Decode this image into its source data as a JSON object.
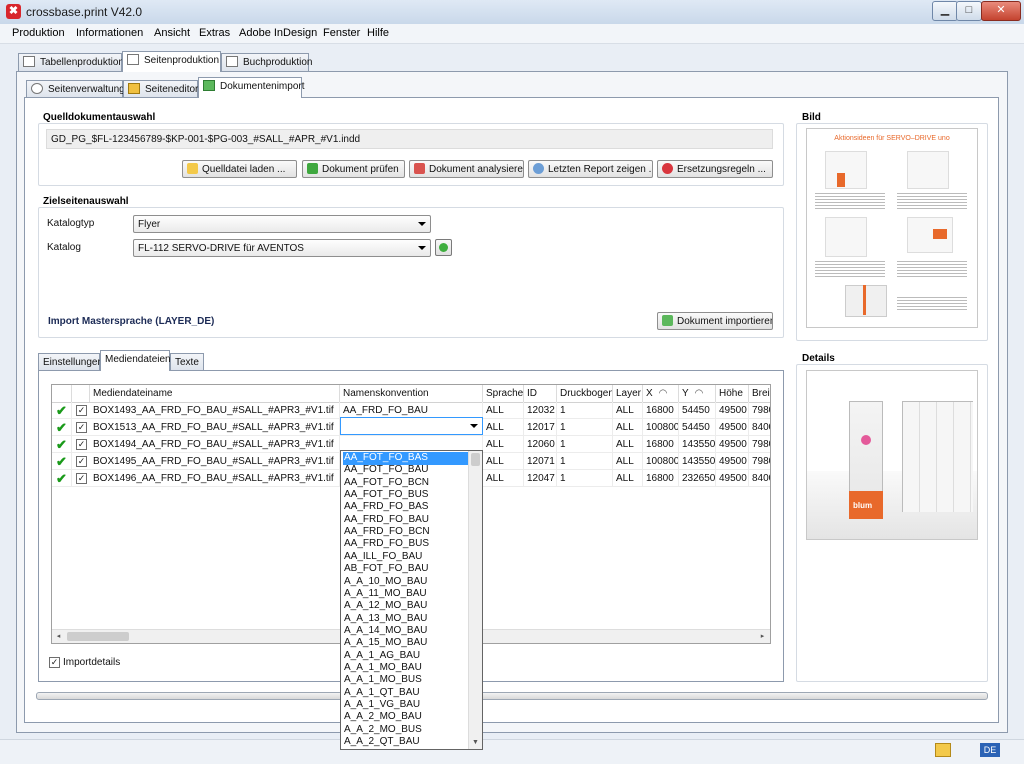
{
  "window": {
    "title": "crossbase.print V42.0",
    "app_icon_glyph": "✖",
    "btn_min": "▁",
    "btn_max": "□",
    "btn_close": "✕"
  },
  "menu": [
    "Produktion",
    "Informationen",
    "Ansicht",
    "Extras",
    "Adobe InDesign",
    "Fenster",
    "Hilfe"
  ],
  "main_tabs": [
    "Tabellenproduktion",
    "Seitenproduktion",
    "Buchproduktion"
  ],
  "sub_tabs": [
    "Seitenverwaltung",
    "Seiteneditor",
    "Dokumentenimport"
  ],
  "quell": {
    "title": "Quelldokumentauswahl",
    "path": "GD_PG_$FL-123456789-$KP-001-$PG-003_#SALL_#APR_#V1.indd",
    "buttons": [
      "Quelldatei laden ...",
      "Dokument prüfen",
      "Dokument analysieren",
      "Letzten Report zeigen ...",
      "Ersetzungsregeln ..."
    ]
  },
  "ziel": {
    "title": "Zielseitenauswahl",
    "katalogtyp_label": "Katalogtyp",
    "katalogtyp_value": "Flyer",
    "katalog_label": "Katalog",
    "katalog_value": "FL-112 SERVO-DRIVE für AVENTOS",
    "import_master": "Import Mastersprache (LAYER_DE)",
    "import_button": "Dokument importieren"
  },
  "inner_tabs": [
    "Einstellungen",
    "Mediendateien",
    "Texte"
  ],
  "grid": {
    "headers": [
      "Mediendateiname",
      "Namenskonvention",
      "Sprache",
      "ID",
      "Druckbogen",
      "Layer",
      "X",
      "Y",
      "Höhe",
      "Breit"
    ],
    "rows": [
      {
        "name": "BOX1493_AA_FRD_FO_BAU_#SALL_#APR3_#V1.tif",
        "konv": "AA_FRD_FO_BAU",
        "sprache": "ALL",
        "id": "12032",
        "druck": "1",
        "layer": "ALL",
        "x": "16800",
        "y": "54450",
        "hoehe": "49500",
        "breite": "7980"
      },
      {
        "name": "BOX1513_AA_FRD_FO_BAU_#SALL_#APR3_#V1.tif",
        "konv": "",
        "sprache": "ALL",
        "id": "12017",
        "druck": "1",
        "layer": "ALL",
        "x": "100800",
        "y": "54450",
        "hoehe": "49500",
        "breite": "8400"
      },
      {
        "name": "BOX1494_AA_FRD_FO_BAU_#SALL_#APR3_#V1.tif",
        "konv": "",
        "sprache": "ALL",
        "id": "12060",
        "druck": "1",
        "layer": "ALL",
        "x": "16800",
        "y": "143550",
        "hoehe": "49500",
        "breite": "7980"
      },
      {
        "name": "BOX1495_AA_FRD_FO_BAU_#SALL_#APR3_#V1.tif",
        "konv": "",
        "sprache": "ALL",
        "id": "12071",
        "druck": "1",
        "layer": "ALL",
        "x": "100800",
        "y": "143550",
        "hoehe": "49500",
        "breite": "7980"
      },
      {
        "name": "BOX1496_AA_FRD_FO_BAU_#SALL_#APR3_#V1.tif",
        "konv": "",
        "sprache": "ALL",
        "id": "12047",
        "druck": "1",
        "layer": "ALL",
        "x": "16800",
        "y": "232650",
        "hoehe": "49500",
        "breite": "8400"
      }
    ],
    "check_glyph": "✔",
    "cbox_glyph": "✓"
  },
  "dropdown": {
    "selected": "AA_FOT_FO_BAS",
    "options": [
      "AA_FOT_FO_BAS",
      "AA_FOT_FO_BAU",
      "AA_FOT_FO_BCN",
      "AA_FOT_FO_BUS",
      "AA_FRD_FO_BAS",
      "AA_FRD_FO_BAU",
      "AA_FRD_FO_BCN",
      "AA_FRD_FO_BUS",
      "AA_ILL_FO_BAU",
      "AB_FOT_FO_BAU",
      "A_A_10_MO_BAU",
      "A_A_11_MO_BAU",
      "A_A_12_MO_BAU",
      "A_A_13_MO_BAU",
      "A_A_14_MO_BAU",
      "A_A_15_MO_BAU",
      "A_A_1_AG_BAU",
      "A_A_1_MO_BAU",
      "A_A_1_MO_BUS",
      "A_A_1_QT_BAU",
      "A_A_1_VG_BAU",
      "A_A_2_MO_BAU",
      "A_A_2_MO_BUS",
      "A_A_2_QT_BAU"
    ]
  },
  "importdetails_label": "Importdetails",
  "bild": {
    "title": "Bild",
    "preview_title": "Aktionsideen für SERVO–DRIVE uno"
  },
  "details": {
    "title": "Details",
    "brand": "blum"
  },
  "status": {
    "lang": "DE"
  },
  "scroll": {
    "left": "◂",
    "right": "▸",
    "up": "▲",
    "down": "▼"
  }
}
